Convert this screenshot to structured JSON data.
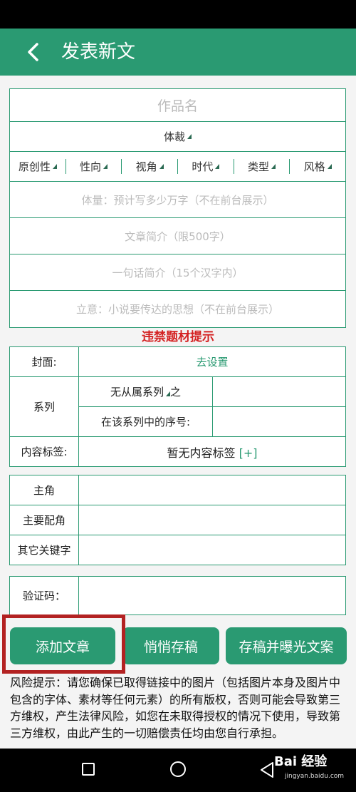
{
  "header": {
    "title": "发表新文"
  },
  "form": {
    "work_name_placeholder": "作品名",
    "genre_label": "体裁",
    "attributes": [
      "原创性",
      "性向",
      "视角",
      "时代",
      "类型",
      "风格"
    ],
    "length_placeholder": "体量：预计写多少万字（不在前台展示）",
    "summary_placeholder": "文章简介（限500字）",
    "oneline_placeholder": "一句话简介（15个汉字内）",
    "theme_placeholder": "立意：小说要传达的思想（不在前台展示）"
  },
  "forbidden_link": "违禁题材提示",
  "meta": {
    "cover_label": "封面:",
    "cover_action": "去设置",
    "series_label": "系列",
    "series_select": "无从属系列",
    "series_select_suffix": "之",
    "series_order_label": "在该系列中的序号:",
    "tags_label": "内容标签:",
    "tags_value": "暂无内容标签",
    "tags_add": "[+]"
  },
  "roles": {
    "main": "主角",
    "supporting": "主要配角",
    "other_keywords": "其它关键字"
  },
  "captcha": {
    "label": "验证码："
  },
  "buttons": {
    "add_chapter": "添加文章",
    "save_draft": "悄悄存稿",
    "save_expose": "存稿并曝光文案"
  },
  "risk_notice": "风险提示：请您确保已取得链接中的图片（包括图片本身及图片中包含的字体、素材等任何元素）的所有版权，否则可能会导致第三方维权，产生法律风险，如您在未取得授权的情况下使用，导致第三方维权，由此产生的一切赔偿责任均由您自行承担。",
  "watermark": {
    "brand": "Bai 经验",
    "url": "jingyan.baidu.com"
  },
  "colors": {
    "accent": "#2a9a72",
    "warning": "#d42222",
    "highlight_box": "#b32222"
  },
  "icons": {
    "back": "chevron-left-icon",
    "dropdown": "triangle-icon",
    "nav_recent": "square-icon",
    "nav_home": "circle-icon",
    "nav_back": "triangle-left-icon"
  }
}
